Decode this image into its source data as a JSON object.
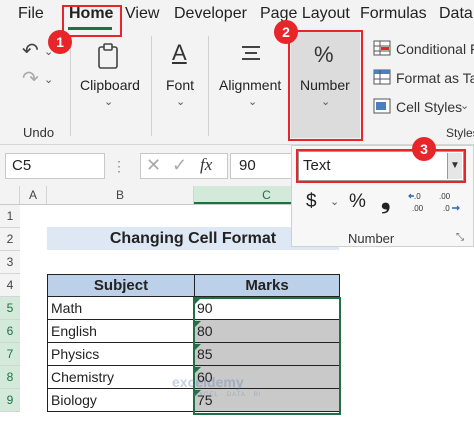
{
  "menu": {
    "items": [
      "File",
      "Home",
      "View",
      "Developer",
      "Page Layout",
      "Formulas",
      "Data"
    ],
    "active": "Home"
  },
  "ribbon": {
    "undo_label": "Undo",
    "clipboard_label": "Clipboard",
    "font_label": "Font",
    "font_icon": "A",
    "alignment_label": "Alignment",
    "number_label": "Number",
    "percent_icon": "%",
    "conditional_label": "Conditional F",
    "format_table_label": "Format as Tab",
    "cell_styles_label": "Cell Styles",
    "styles_group_label": "Styles"
  },
  "formula_bar": {
    "name_box": "C5",
    "fx_symbol": "fx",
    "value": "90"
  },
  "number_panel": {
    "format_value": "Text",
    "currency": "$",
    "percent": "%",
    "comma": "❟",
    "group_label": "Number"
  },
  "badges": [
    "1",
    "2",
    "3"
  ],
  "grid": {
    "columns": [
      "A",
      "B",
      "C"
    ],
    "rows": [
      "1",
      "2",
      "3",
      "4",
      "5",
      "6",
      "7",
      "8",
      "9"
    ],
    "title": "Changing Cell Format",
    "headers": [
      "Subject",
      "Marks"
    ],
    "data": [
      {
        "subject": "Math",
        "marks": "90"
      },
      {
        "subject": "English",
        "marks": "80"
      },
      {
        "subject": "Physics",
        "marks": "85"
      },
      {
        "subject": "Chemistry",
        "marks": "60"
      },
      {
        "subject": "Biology",
        "marks": "75"
      }
    ]
  },
  "watermark": {
    "name": "exceldemy",
    "tagline": "EXCEL · DATA · BI"
  },
  "colors": {
    "accent": "#1e7145",
    "callout": "#e8262a",
    "header_fill": "#bcd0ea",
    "title_fill": "#dde8f4"
  }
}
